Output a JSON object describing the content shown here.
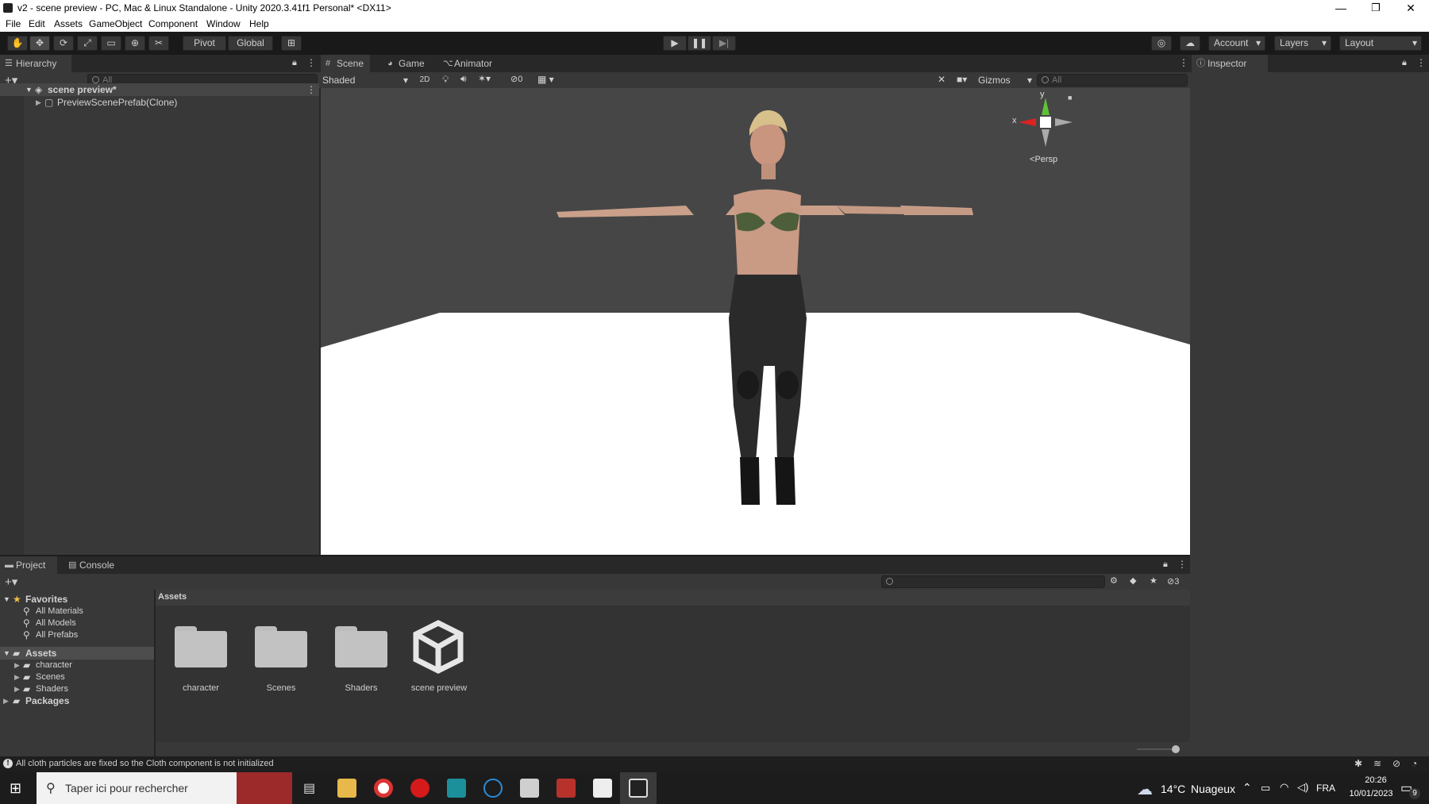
{
  "window": {
    "title": "v2 - scene preview - PC, Mac & Linux Standalone - Unity 2020.3.41f1 Personal* <DX11>",
    "minimize": "—",
    "maximize": "❐",
    "close": "✕"
  },
  "menu": [
    "File",
    "Edit",
    "Assets",
    "GameObject",
    "Component",
    "Window",
    "Help"
  ],
  "toolbar": {
    "pivot": "Pivot",
    "global": "Global",
    "account": "Account",
    "layers": "Layers",
    "layout": "Layout"
  },
  "hierarchy": {
    "tab": "Hierarchy",
    "search_placeholder": "All",
    "scene": "scene preview*",
    "child": "PreviewScenePrefab(Clone)"
  },
  "scene_view": {
    "tabs": [
      "Scene",
      "Game",
      "Animator"
    ],
    "shading": "Shaded",
    "mode_2d": "2D",
    "hidden_count": "0",
    "gizmos": "Gizmos",
    "search_placeholder": "All",
    "axis_x": "x",
    "axis_y": "y",
    "projection": "Persp"
  },
  "inspector": {
    "tab": "Inspector"
  },
  "project": {
    "tabs": [
      "Project",
      "Console"
    ],
    "favorites_label": "Favorites",
    "favorites": [
      "All Materials",
      "All Models",
      "All Prefabs"
    ],
    "assets_label": "Assets",
    "asset_folders": [
      "character",
      "Scenes",
      "Shaders"
    ],
    "packages_label": "Packages",
    "breadcrumb": "Assets",
    "items": [
      "character",
      "Scenes",
      "Shaders",
      "scene preview"
    ],
    "hidden_count": "3"
  },
  "status": {
    "message": "All cloth particles are fixed so the Cloth component is not initialized"
  },
  "taskbar": {
    "search_placeholder": "Taper ici pour rechercher",
    "weather_temp": "14°C",
    "weather_desc": "Nuageux",
    "language": "FRA",
    "time": "20:26",
    "date": "10/01/2023",
    "notif_count": "9"
  },
  "colors": {
    "accent_unity_selected": "#2c5d87",
    "sky": "#464646",
    "ground": "#ffffff",
    "panel": "#383838"
  }
}
